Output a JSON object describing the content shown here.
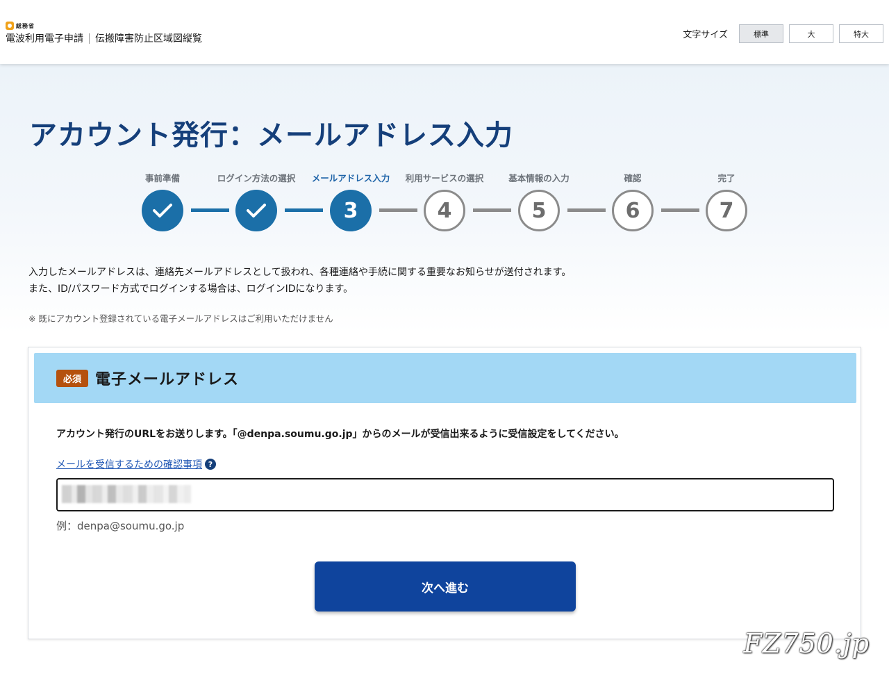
{
  "header": {
    "ministry": "総務省",
    "site_name": "電波利用電子申請",
    "site_sub": "伝搬障害防止区域図縦覧",
    "font_size": {
      "label": "文字サイズ",
      "options": [
        "標準",
        "大",
        "特大"
      ],
      "selected": "標準"
    }
  },
  "page": {
    "title": "アカウント発行：メールアドレス入力"
  },
  "stepper": {
    "current_step": 3,
    "steps": [
      {
        "label": "事前準備",
        "num": "✓",
        "state": "done"
      },
      {
        "label": "ログイン方法の選択",
        "num": "✓",
        "state": "done"
      },
      {
        "label": "メールアドレス入力",
        "num": "3",
        "state": "current"
      },
      {
        "label": "利用サービスの選択",
        "num": "4",
        "state": "todo"
      },
      {
        "label": "基本情報の入力",
        "num": "5",
        "state": "todo"
      },
      {
        "label": "確認",
        "num": "6",
        "state": "todo"
      },
      {
        "label": "完了",
        "num": "7",
        "state": "todo"
      }
    ]
  },
  "description": {
    "line1": "入力したメールアドレスは、連絡先メールアドレスとして扱われ、各種連絡や手続に関する重要なお知らせが送付されます。",
    "line2": "また、ID/パスワード方式でログインする場合は、ログインIDになります。",
    "note": "※ 既にアカウント登録されている電子メールアドレスはご利用いただけません"
  },
  "form": {
    "required_badge": "必須",
    "section_title": "電子メールアドレス",
    "instruction": "アカウント発行のURLをお送りします。「@denpa.soumu.go.jp」からのメールが受信出来るように受信設定をしてください。",
    "help_link": "メールを受信するための確認事項",
    "help_icon": "?",
    "email_value": "",
    "example": "例：denpa@soumu.go.jp",
    "submit_label": "次へ進む"
  },
  "watermark": "FZ750.jp",
  "colors": {
    "title": "#153f7a",
    "step_active": "#1b6fa8",
    "step_inactive": "#8b8b8b",
    "section_header": "#a3d8f5",
    "required_badge": "#b5510e",
    "primary_button": "#0f449d"
  }
}
